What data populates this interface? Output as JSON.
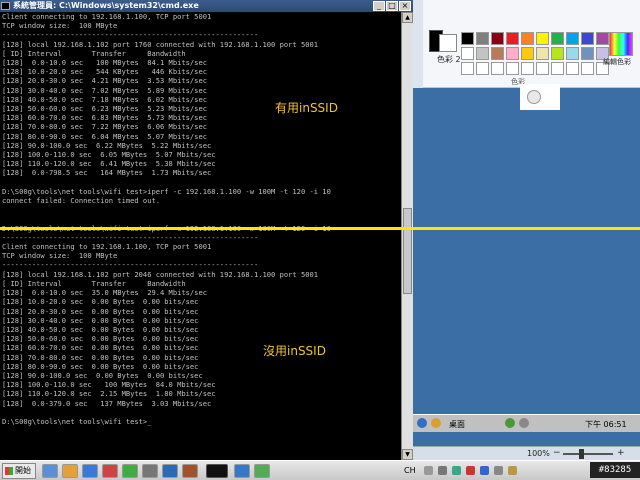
{
  "cmd": {
    "title": "系統管理員: C:\\Windows\\system32\\cmd.exe",
    "lines": [
      "Client connecting to 192.168.1.100, TCP port 5001",
      "TCP window size:  100 MByte",
      "------------------------------------------------------------",
      "[128] local 192.168.1.102 port 1760 connected with 192.168.1.100 port 5001",
      "[ ID] Interval       Transfer     Bandwidth",
      "[128]  0.0-10.0 sec   100 MBytes  84.1 Mbits/sec",
      "[128] 10.0-20.0 sec   544 KBytes   446 Kbits/sec",
      "[128] 20.0-30.0 sec  4.21 MBytes  3.53 Mbits/sec",
      "[128] 30.0-40.0 sec  7.02 MBytes  5.89 Mbits/sec",
      "[128] 40.0-50.0 sec  7.18 MBytes  6.02 Mbits/sec",
      "[128] 50.0-60.0 sec  6.23 MBytes  5.23 Mbits/sec",
      "[128] 60.0-70.0 sec  6.83 MBytes  5.73 Mbits/sec",
      "[128] 70.0-80.0 sec  7.22 MBytes  6.06 Mbits/sec",
      "[128] 80.0-90.0 sec  6.04 MBytes  5.07 Mbits/sec",
      "[128] 90.0-100.0 sec  6.22 MBytes  5.22 Mbits/sec",
      "[128] 100.0-110.0 sec  6.05 MBytes  5.07 Mbits/sec",
      "[128] 110.0-120.0 sec  6.41 MBytes  5.38 Mbits/sec",
      "[128]  0.0-798.5 sec   164 MBytes  1.73 Mbits/sec",
      "",
      "D:\\S00g\\tools\\net tools\\wifi test>iperf -c 192.168.1.100 -w 100M -t 120 -i 10",
      "connect failed: Connection timed out.",
      "",
      "",
      "D:\\S00g\\tools\\net tools\\wifi test>iperf -c 192.168.1.100 -w 100M -t 120 -i 10",
      "------------------------------------------------------------",
      "Client connecting to 192.168.1.100, TCP port 5001",
      "TCP window size:  100 MByte",
      "------------------------------------------------------------",
      "[128] local 192.168.1.102 port 2046 connected with 192.168.1.100 port 5001",
      "[ ID] Interval       Transfer     Bandwidth",
      "[128]  0.0-10.0 sec  35.0 MBytes  29.4 Mbits/sec",
      "[128] 10.0-20.0 sec  0.00 Bytes  0.00 bits/sec",
      "[128] 20.0-30.0 sec  0.00 Bytes  0.00 bits/sec",
      "[128] 30.0-40.0 sec  0.00 Bytes  0.00 bits/sec",
      "[128] 40.0-50.0 sec  0.00 Bytes  0.00 bits/sec",
      "[128] 50.0-60.0 sec  0.00 Bytes  0.00 bits/sec",
      "[128] 60.0-70.0 sec  0.00 Bytes  0.00 bits/sec",
      "[128] 70.0-80.0 sec  0.00 Bytes  0.00 bits/sec",
      "[128] 80.0-90.0 sec  0.00 Bytes  0.00 bits/sec",
      "[128] 90.0-100.0 sec  0.00 Bytes  0.00 bits/sec",
      "[128] 100.0-110.0 sec   100 MBytes  84.0 Mbits/sec",
      "[128] 110.0-120.0 sec  2.15 MBytes  1.80 Mbits/sec",
      "[128]  0.0-379.0 sec   137 MBytes  3.03 Mbits/sec",
      "",
      "D:\\S00g\\tools\\net tools\\wifi test>_"
    ]
  },
  "annotations": {
    "with_inssid": "有用inSSID",
    "without_inssid": "沒用inSSID"
  },
  "paint": {
    "color2_label": "色彩 2",
    "edit_colors_label": "編輯色彩",
    "group_label": "色彩",
    "zoom": "100%",
    "swatch_colors": [
      "#000000",
      "#7f7f7f",
      "#880015",
      "#ed1c24",
      "#ff7f27",
      "#fff200",
      "#22b14c",
      "#00a2e8",
      "#3f48cc",
      "#a349a4",
      "#ffffff",
      "#c3c3c3",
      "#b97a57",
      "#ffaec9",
      "#ffc90e",
      "#efe4b0",
      "#b5e61d",
      "#99d9ea",
      "#7092be",
      "#c8bfe7",
      "#ffffff",
      "#ffffff",
      "#ffffff",
      "#ffffff",
      "#ffffff",
      "#ffffff",
      "#ffffff",
      "#ffffff",
      "#ffffff",
      "#ffffff"
    ]
  },
  "inner_taskbar": {
    "desktop_label": "桌面",
    "clock": "下午 06:51"
  },
  "taskbar": {
    "start_label": "開始",
    "language": "CH"
  },
  "watermark": "#83285"
}
